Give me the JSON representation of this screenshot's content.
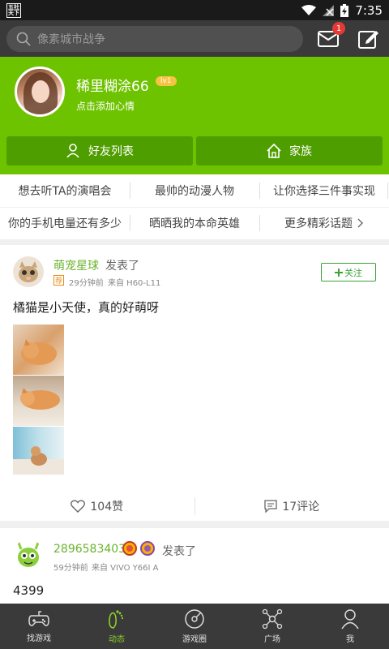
{
  "status": {
    "time": "7:35",
    "app_badge": "五社\n天下"
  },
  "search": {
    "placeholder": "像素城市战争"
  },
  "notifications": {
    "count": "1"
  },
  "profile": {
    "username": "稀里糊涂66",
    "level": "lv1",
    "mood": "点击添加心情",
    "friends_label": "好友列表",
    "family_label": "家族"
  },
  "topics": {
    "row1": [
      "想去听TA的演唱会",
      "最帅的动漫人物",
      "让你选择三件事实现"
    ],
    "row2": [
      "你的手机电量还有多少",
      "晒晒我的本命英雄",
      "更多精彩话题"
    ]
  },
  "posts": [
    {
      "name": "萌宠星球",
      "verb": "发表了",
      "rec": "荐",
      "time": "29分钟前",
      "device": "来自 H60-L11",
      "follow": "关注",
      "text": "橘猫是小天使，真的好萌呀",
      "likes": "104赞",
      "comments": "17评论"
    },
    {
      "name": "2896583403",
      "verb": "发表了",
      "time": "59分钟前",
      "device": "来自 VIVO Y66I A",
      "text": "4399"
    }
  ],
  "nav": [
    {
      "label": "找游戏",
      "icon": "gamepad-icon"
    },
    {
      "label": "动态",
      "icon": "footprint-icon"
    },
    {
      "label": "游戏圈",
      "icon": "circle-game-icon"
    },
    {
      "label": "广场",
      "icon": "network-icon"
    },
    {
      "label": "我",
      "icon": "user-icon"
    }
  ],
  "colors": {
    "accent": "#6ec300",
    "dark_button": "#4f9e00",
    "nav_bg": "#3a3a3a",
    "name_green": "#6ab32c"
  }
}
